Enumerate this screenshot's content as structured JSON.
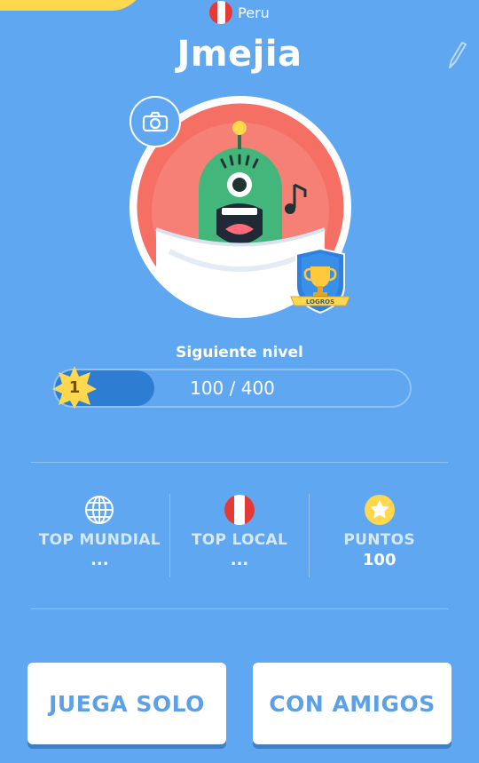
{
  "profile": {
    "country": "Peru",
    "username": "Jmejia",
    "badge_label": "LOGROS"
  },
  "level": {
    "label": "Siguiente nivel",
    "number": "1",
    "progress_text": "100 / 400",
    "progress_fraction": 0.25
  },
  "stats": [
    {
      "icon": "globe-icon",
      "label": "TOP MUNDIAL",
      "value": "..."
    },
    {
      "icon": "peru-flag-icon",
      "label": "TOP LOCAL",
      "value": "..."
    },
    {
      "icon": "star-coin-icon",
      "label": "PUNTOS",
      "value": "100"
    }
  ],
  "buttons": {
    "solo": "JUEGA SOLO",
    "friends": "CON AMIGOS"
  },
  "colors": {
    "background": "#5fa7f1",
    "accent_yellow": "#ffd84d",
    "avatar_red": "#f56f64",
    "monster_green": "#43b77b"
  }
}
